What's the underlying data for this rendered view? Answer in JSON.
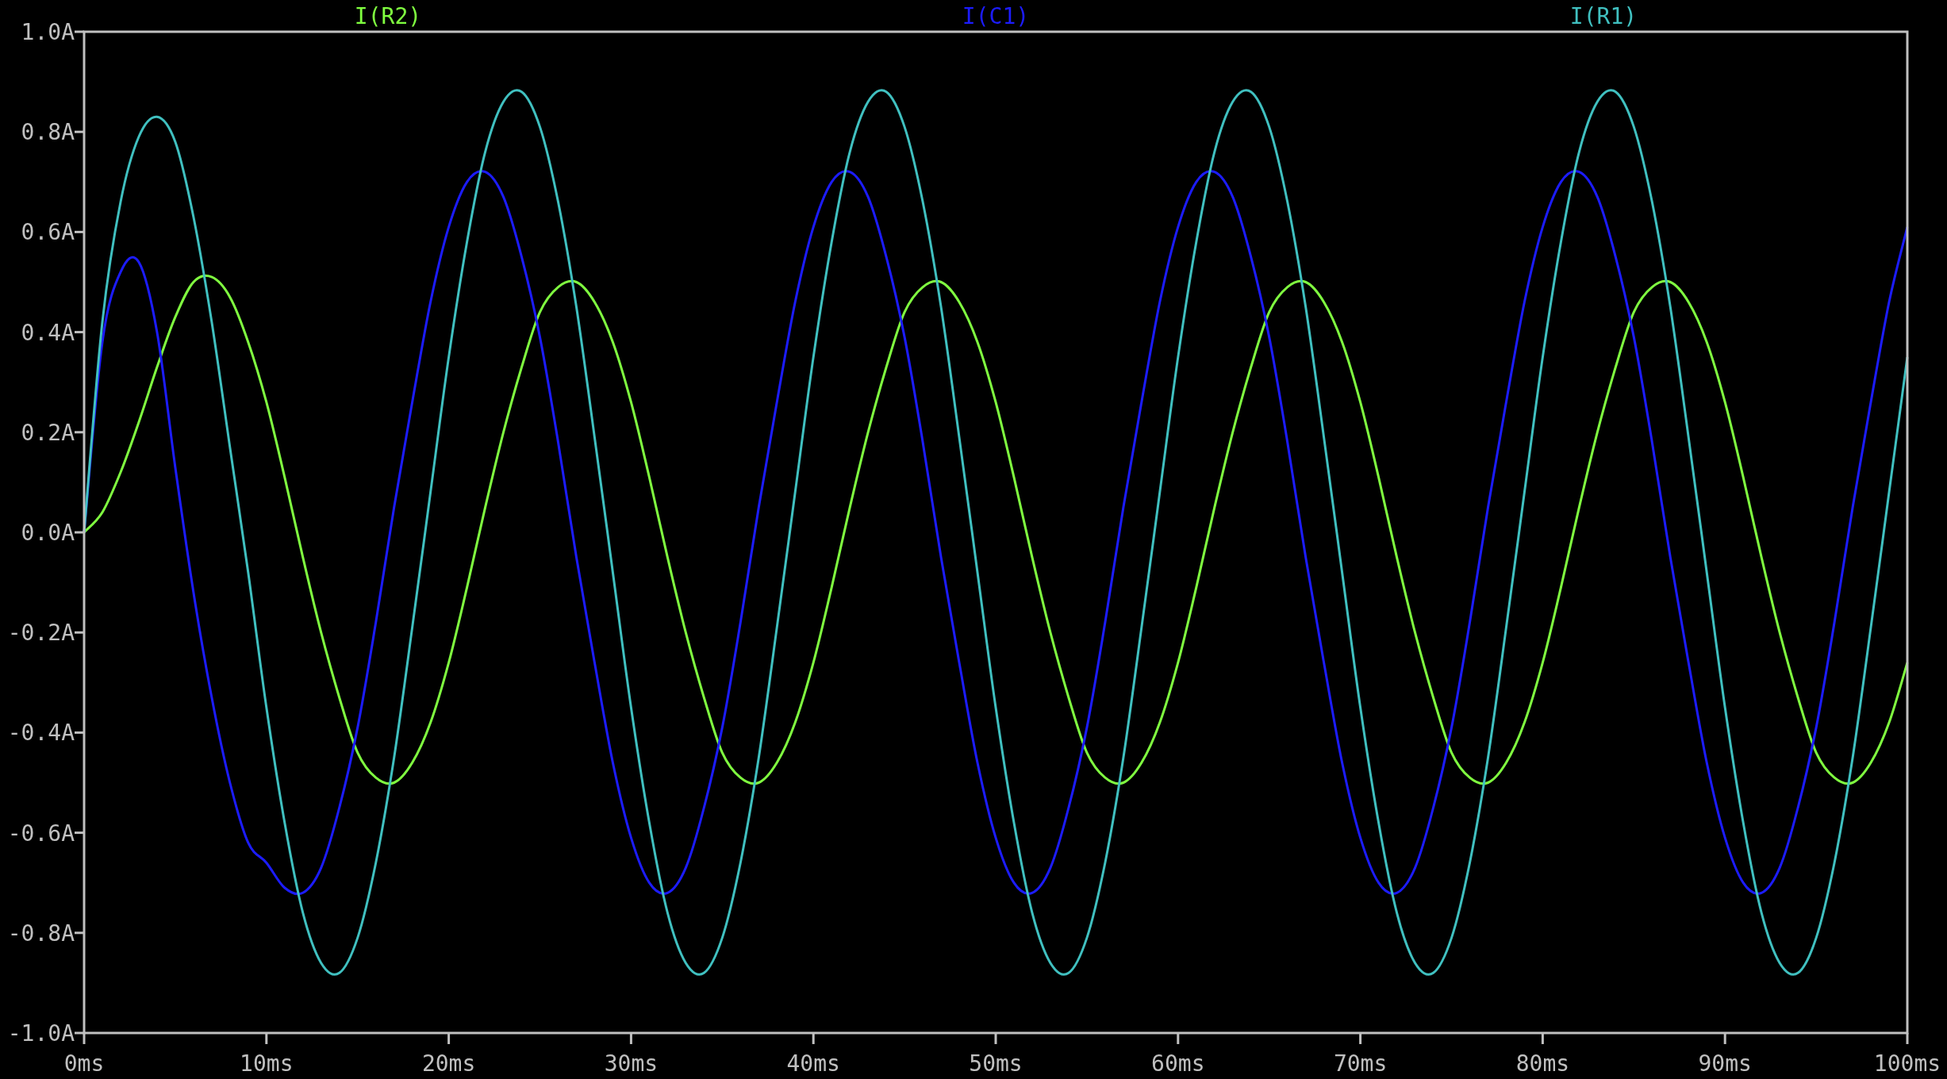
{
  "chart_data": {
    "type": "line",
    "xlim": [
      0,
      100
    ],
    "ylim": [
      -1,
      1
    ],
    "xticks": [
      {
        "value": 0,
        "label": "0ms"
      },
      {
        "value": 10,
        "label": "10ms"
      },
      {
        "value": 20,
        "label": "20ms"
      },
      {
        "value": 30,
        "label": "30ms"
      },
      {
        "value": 40,
        "label": "40ms"
      },
      {
        "value": 50,
        "label": "50ms"
      },
      {
        "value": 60,
        "label": "60ms"
      },
      {
        "value": 70,
        "label": "70ms"
      },
      {
        "value": 80,
        "label": "80ms"
      },
      {
        "value": 90,
        "label": "90ms"
      },
      {
        "value": 100,
        "label": "100ms"
      }
    ],
    "yticks": [
      {
        "value": 1,
        "label": "1.0A"
      },
      {
        "value": 0.8,
        "label": "0.8A"
      },
      {
        "value": 0.6,
        "label": "0.6A"
      },
      {
        "value": 0.4,
        "label": "0.4A"
      },
      {
        "value": 0.2,
        "label": "0.2A"
      },
      {
        "value": 0,
        "label": "0.0A"
      },
      {
        "value": -0.2,
        "label": "-0.2A"
      },
      {
        "value": -0.4,
        "label": "-0.4A"
      },
      {
        "value": -0.6,
        "label": "-0.6A"
      },
      {
        "value": -0.8,
        "label": "-0.8A"
      },
      {
        "value": -1,
        "label": "-1.0A"
      }
    ],
    "x": [
      0,
      1,
      2,
      3,
      4,
      5,
      6,
      7,
      8,
      9,
      10,
      11,
      12,
      13,
      14,
      15,
      16,
      17,
      18,
      19,
      20,
      21,
      22,
      23,
      24,
      25,
      26,
      27,
      28,
      29,
      30,
      31,
      32,
      33,
      34,
      35,
      36,
      37,
      38,
      39,
      40,
      41,
      42,
      43,
      44,
      45,
      46,
      47,
      48,
      49,
      50,
      51,
      52,
      53,
      54,
      55,
      56,
      57,
      58,
      59,
      60,
      61,
      62,
      63,
      64,
      65,
      66,
      67,
      68,
      69,
      70,
      71,
      72,
      73,
      74,
      75,
      76,
      77,
      78,
      79,
      80,
      81,
      82,
      83,
      84,
      85,
      86,
      87,
      88,
      89,
      90,
      91,
      92,
      93,
      94,
      95,
      96,
      97,
      98,
      99,
      100
    ],
    "series": [
      {
        "name": "I(R2)",
        "color": "#80ff40",
        "values": [
          0,
          0.04,
          0.12,
          0.22,
          0.33,
          0.43,
          0.5,
          0.51,
          0.47,
          0.38,
          0.26,
          0.11,
          -0.05,
          -0.2,
          -0.33,
          -0.44,
          -0.49,
          -0.5,
          -0.46,
          -0.38,
          -0.26,
          -0.11,
          0.05,
          0.2,
          0.33,
          0.44,
          0.49,
          0.5,
          0.46,
          0.38,
          0.26,
          0.11,
          -0.05,
          -0.2,
          -0.33,
          -0.44,
          -0.49,
          -0.5,
          -0.46,
          -0.38,
          -0.26,
          -0.11,
          0.05,
          0.2,
          0.33,
          0.44,
          0.49,
          0.5,
          0.46,
          0.38,
          0.26,
          0.11,
          -0.05,
          -0.2,
          -0.33,
          -0.44,
          -0.49,
          -0.5,
          -0.46,
          -0.38,
          -0.26,
          -0.11,
          0.05,
          0.2,
          0.33,
          0.44,
          0.49,
          0.5,
          0.46,
          0.38,
          0.26,
          0.11,
          -0.05,
          -0.2,
          -0.33,
          -0.44,
          -0.49,
          -0.5,
          -0.46,
          -0.38,
          -0.26,
          -0.11,
          0.05,
          0.2,
          0.33,
          0.44,
          0.49,
          0.5,
          0.46,
          0.38,
          0.26,
          0.11,
          -0.05,
          -0.2,
          -0.33,
          -0.44,
          -0.49,
          -0.5,
          -0.46,
          -0.38,
          -0.26
        ]
      },
      {
        "name": "I(C1)",
        "color": "#1c1cff",
        "values": [
          0,
          0.38,
          0.52,
          0.54,
          0.4,
          0.13,
          -0.12,
          -0.33,
          -0.5,
          -0.62,
          -0.66,
          -0.71,
          -0.72,
          -0.67,
          -0.55,
          -0.39,
          -0.18,
          0.05,
          0.26,
          0.46,
          0.61,
          0.7,
          0.72,
          0.67,
          0.55,
          0.39,
          0.18,
          -0.05,
          -0.26,
          -0.46,
          -0.61,
          -0.7,
          -0.72,
          -0.67,
          -0.55,
          -0.39,
          -0.18,
          0.05,
          0.26,
          0.46,
          0.61,
          0.7,
          0.72,
          0.67,
          0.55,
          0.39,
          0.18,
          -0.05,
          -0.26,
          -0.46,
          -0.61,
          -0.7,
          -0.72,
          -0.67,
          -0.55,
          -0.39,
          -0.18,
          0.05,
          0.26,
          0.46,
          0.61,
          0.7,
          0.72,
          0.67,
          0.55,
          0.39,
          0.18,
          -0.05,
          -0.26,
          -0.46,
          -0.61,
          -0.7,
          -0.72,
          -0.67,
          -0.55,
          -0.39,
          -0.18,
          0.05,
          0.26,
          0.46,
          0.61,
          0.7,
          0.72,
          0.67,
          0.55,
          0.39,
          0.18,
          -0.05,
          -0.26,
          -0.46,
          -0.61,
          -0.7,
          -0.72,
          -0.67,
          -0.55,
          -0.39,
          -0.18,
          0.05,
          0.26,
          0.46,
          0.61
        ]
      },
      {
        "name": "I(R1)",
        "color": "#40c0c0",
        "values": [
          0,
          0.42,
          0.66,
          0.79,
          0.83,
          0.78,
          0.63,
          0.42,
          0.17,
          -0.08,
          -0.35,
          -0.58,
          -0.76,
          -0.86,
          -0.88,
          -0.81,
          -0.66,
          -0.45,
          -0.19,
          0.08,
          0.35,
          0.58,
          0.76,
          0.86,
          0.88,
          0.81,
          0.66,
          0.45,
          0.19,
          -0.08,
          -0.35,
          -0.58,
          -0.76,
          -0.86,
          -0.88,
          -0.81,
          -0.66,
          -0.45,
          -0.19,
          0.08,
          0.35,
          0.58,
          0.76,
          0.86,
          0.88,
          0.81,
          0.66,
          0.45,
          0.19,
          -0.08,
          -0.35,
          -0.58,
          -0.76,
          -0.86,
          -0.88,
          -0.81,
          -0.66,
          -0.45,
          -0.19,
          0.08,
          0.35,
          0.58,
          0.76,
          0.86,
          0.88,
          0.81,
          0.66,
          0.45,
          0.19,
          -0.08,
          -0.35,
          -0.58,
          -0.76,
          -0.86,
          -0.88,
          -0.81,
          -0.66,
          -0.45,
          -0.19,
          0.08,
          0.35,
          0.58,
          0.76,
          0.86,
          0.88,
          0.81,
          0.66,
          0.45,
          0.19,
          -0.08,
          -0.35,
          -0.58,
          -0.76,
          -0.86,
          -0.88,
          -0.81,
          -0.66,
          -0.45,
          -0.19,
          0.08,
          0.35
        ]
      }
    ]
  }
}
